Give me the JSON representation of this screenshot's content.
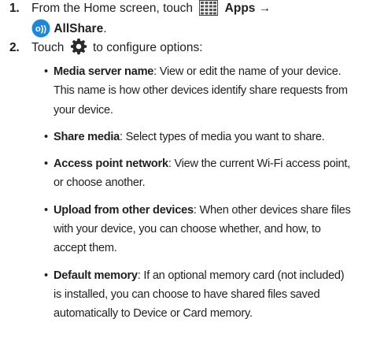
{
  "steps": [
    {
      "number": "1.",
      "text_before": "From the Home screen, touch",
      "apps_label": "Apps",
      "arrow": "→",
      "allshare_label": "AllShare",
      "end": ".",
      "icons": [
        "apps-grid-icon",
        "allshare-app-icon"
      ]
    },
    {
      "number": "2.",
      "text_before": "Touch",
      "text_after": "to configure options:",
      "icon": "settings-gear-icon",
      "bullets": [
        {
          "term": "Media server name",
          "desc": ": View or edit the name of your device. This name is how other devices identify share requests from your device."
        },
        {
          "term": "Share media",
          "desc": ": Select types of media you want to share."
        },
        {
          "term": "Access point network",
          "desc": ": View the current Wi-Fi access point, or choose another."
        },
        {
          "term": "Upload from other devices",
          "desc": ": When other devices share files with your device, you can choose whether, and how, to accept them."
        },
        {
          "term": "Default memory",
          "desc": ": If an optional memory card (not included) is installed, you can choose to have shared files saved automatically to Device or Card memory."
        }
      ]
    }
  ],
  "colors": {
    "allshare_blue": "#1e88d6",
    "text": "#1f1f1f"
  }
}
